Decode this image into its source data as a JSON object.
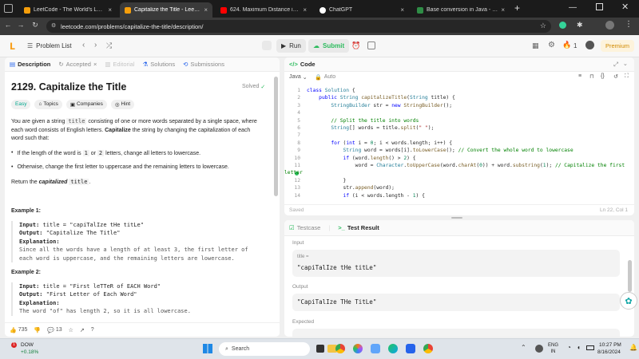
{
  "browser": {
    "tabs": [
      {
        "label": "LeetCode - The World's Leadin",
        "color": "#f59e0b",
        "active": false
      },
      {
        "label": "Capitalize the Title - LeetCode",
        "color": "#f59e0b",
        "active": true
      },
      {
        "label": "624. Maximum Distance in Arra",
        "color": "#ff0000",
        "active": false
      },
      {
        "label": "ChatGPT",
        "color": "#ffffff",
        "active": false
      },
      {
        "label": "Base conversion in Java - Geek",
        "color": "#2f8d46",
        "active": false
      }
    ],
    "new_tab": "+",
    "url": "leetcode.com/problems/capitalize-the-title/description/"
  },
  "header": {
    "problem_list": "Problem List",
    "run": "Run",
    "submit": "Submit",
    "streak": "1",
    "premium": "Premium"
  },
  "left": {
    "tabs": {
      "description": "Description",
      "accepted": "Accepted",
      "editorial": "Editorial",
      "solutions": "Solutions",
      "submissions": "Submissions"
    },
    "title": "2129. Capitalize the Title",
    "solved": "Solved",
    "tags": {
      "difficulty": "Easy",
      "topics": "Topics",
      "companies": "Companies",
      "hint": "Hint"
    },
    "desc_1a": "You are given a string ",
    "desc_code": "title",
    "desc_1b": " consisting of one or more words separated by a single space, where",
    "desc_2": "each word consists of English letters. ",
    "desc_cap": "Capitalize",
    "desc_3": " the string by changing the capitalization of each",
    "desc_4": "word such that:",
    "bullet1a": "If the length of the word is ",
    "bullet1b": "1",
    "bullet1c": " or ",
    "bullet1d": "2",
    "bullet1e": " letters, change all letters to lowercase.",
    "bullet2": "Otherwise, change the first letter to uppercase and the remaining letters to lowercase.",
    "ret_a": "Return the ",
    "ret_b": "capitalized",
    "ret_c": "title",
    "ret_d": ".",
    "ex1_title": "Example 1:",
    "ex1_input_lbl": "Input:",
    "ex1_input": "title = \"capiTalIze tHe titLe\"",
    "ex1_output_lbl": "Output:",
    "ex1_output": "\"Capitalize The Title\"",
    "ex1_expl_lbl": "Explanation:",
    "ex1_expl1": "Since all the words have a length of at least 3, the first letter of",
    "ex1_expl2": "each word is uppercase, and the remaining letters are lowercase.",
    "ex2_title": "Example 2:",
    "ex2_input_lbl": "Input:",
    "ex2_input": "title = \"First leTTeR of EACH Word\"",
    "ex2_output_lbl": "Output:",
    "ex2_output": "\"First Letter of Each Word\"",
    "ex2_expl_lbl": "Explanation:",
    "ex2_expl1": "The word \"of\" has length 2, so it is all lowercase.",
    "likes": "735",
    "comments": "13"
  },
  "code": {
    "tab": "Code",
    "lang": "Java",
    "auto": "Auto",
    "saved": "Saved",
    "cursor": "Ln 22, Col 1",
    "line_numbers": [
      "1",
      "2",
      "3",
      "4",
      "5",
      "6",
      "7",
      "8",
      "9",
      "10",
      "11",
      "12",
      "13",
      "14"
    ]
  },
  "test": {
    "tab_testcase": "Testcase",
    "tab_result": "Test Result",
    "input_lbl": "Input",
    "var_lbl": "title =",
    "input_val": "\"capiTalIze tHe titLe\"",
    "output_lbl": "Output",
    "output_val": "\"CapiTalIze THe TitLe\"",
    "expected_lbl": "Expected"
  },
  "taskbar": {
    "stock": "DOW",
    "stock_change": "+0.18%",
    "badge": "1",
    "search": "Search",
    "lang1": "ENG",
    "lang2": "IN",
    "time": "10:27 PM",
    "date": "8/16/2024"
  }
}
